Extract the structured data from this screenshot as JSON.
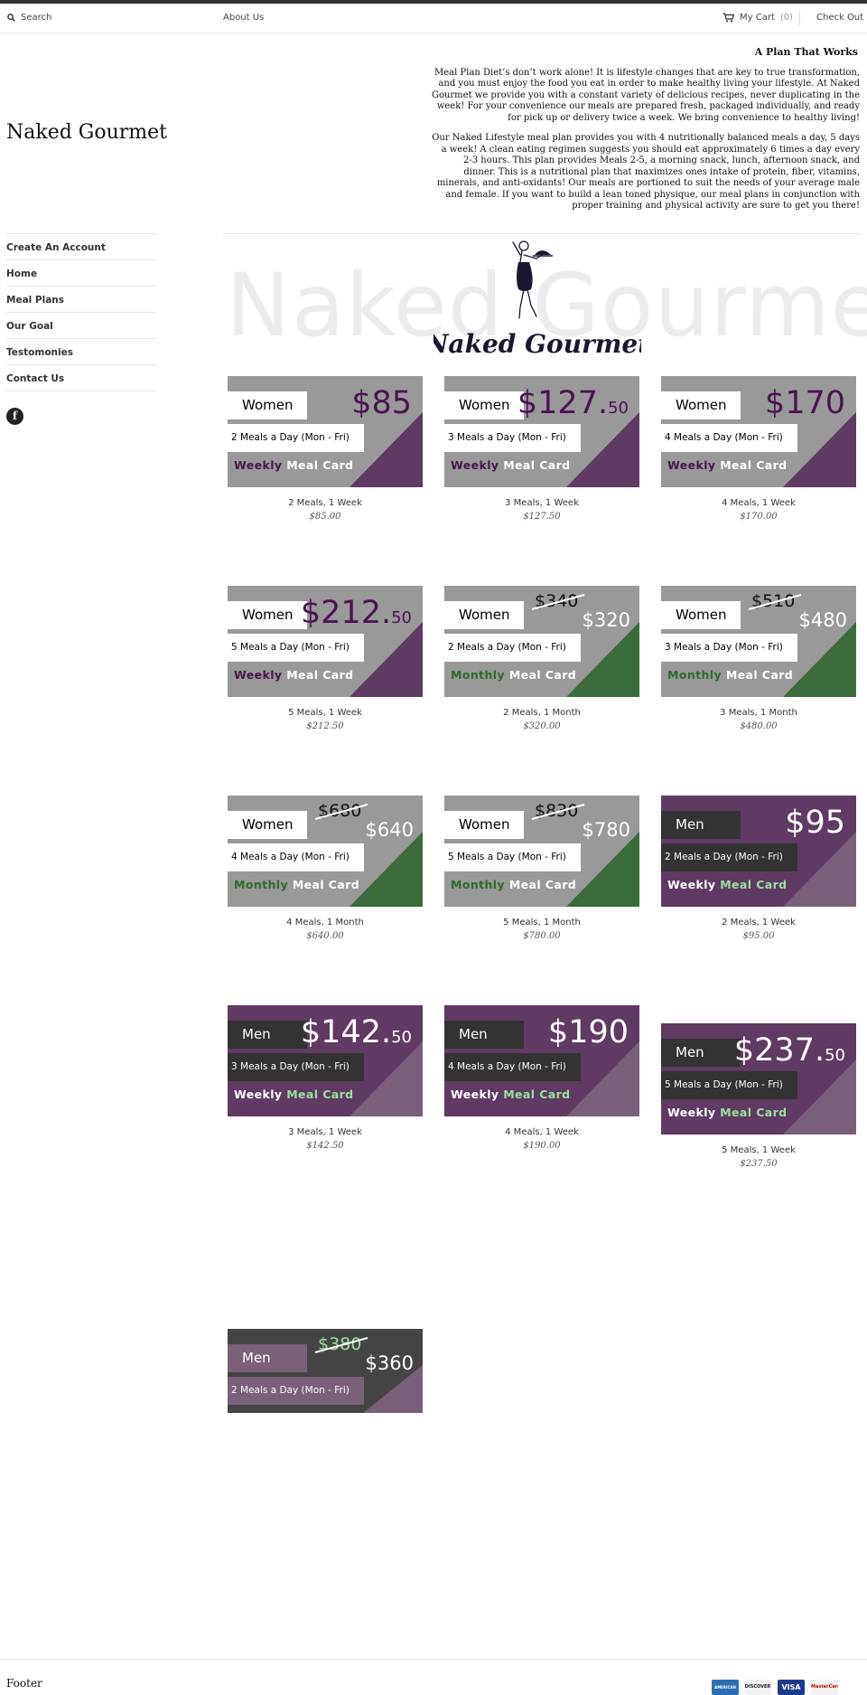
{
  "topbar": {
    "search_label": "Search",
    "about_label": "About Us",
    "cart_label": "My Cart",
    "cart_count": "(0)",
    "checkout_label": "Check Out"
  },
  "brand": {
    "name": "Naked Gourmet"
  },
  "sidebar": {
    "items": [
      {
        "label": "Create An Account"
      },
      {
        "label": "Home"
      },
      {
        "label": "Meal Plans"
      },
      {
        "label": "Our Goal"
      },
      {
        "label": "Testomonies"
      },
      {
        "label": "Contact Us"
      }
    ],
    "social_icon": "facebook-icon"
  },
  "intro": {
    "heading": "A Plan That Works",
    "p1": "Meal Plan Diet’s don’t work alone! It is lifestyle changes that are key to true transformation, and you must enjoy the food you eat in order to make healthy living your lifestyle. At Naked Gourmet we provide you with a constant variety of delicious recipes, never duplicating in the week! For your convenience our meals are prepared fresh, packaged individually, and ready for pick up or delivery twice a week. We bring convenience to healthy living!",
    "p2": "Our Naked Lifestyle meal plan provides you with 4 nutritionally balanced meals a day, 5 days a week! A clean eating regimen suggests you should eat approximately 6 times a day every 2-3 hours. This plan provides Meals 2-5, a morning snack, lunch, afternoon snack, and dinner. This is a nutritional plan that maximizes ones intake of protein, fiber, vitamins, minerals, and anti-oxidants! Our meals are portioned to suit the needs of your average male and female. If you want to build a lean toned physique, our meal plans in conjunction with proper training and physical activity are sure to get you there!"
  },
  "banner": {
    "watermark": "Naked Gourmet",
    "logo_text": "Naked Gourmet"
  },
  "colors": {
    "women_bg": "#999999",
    "women_weekly_accent": "#5f3a63",
    "women_monthly_accent": "#3b6b3d",
    "men_bg": "#5f3a63",
    "men_accent": "#7a5f7a",
    "dark_bg": "#444444",
    "price_purple": "#4a1450",
    "monthly_green": "#2e6b2e",
    "men_label_green": "#9be09b"
  },
  "products": [
    {
      "title": "2 Meals, 1 Week",
      "price": "$85.00",
      "gender": "Women",
      "meals": "2 Meals a Day (Mon - Fri)",
      "card_price": "$85",
      "card_cents": "",
      "old_price": "",
      "plan": "Weekly",
      "card_word": "Meal Card"
    },
    {
      "title": "3 Meals, 1 Week",
      "price": "$127.50",
      "gender": "Women",
      "meals": "3 Meals a Day (Mon - Fri)",
      "card_price": "$127.",
      "card_cents": "50",
      "old_price": "",
      "plan": "Weekly",
      "card_word": "Meal Card"
    },
    {
      "title": "4 Meals, 1 Week",
      "price": "$170.00",
      "gender": "Women",
      "meals": "4 Meals a Day (Mon - Fri)",
      "card_price": "$170",
      "card_cents": "",
      "old_price": "",
      "plan": "Weekly",
      "card_word": "Meal Card"
    },
    {
      "title": "5 Meals, 1 Week",
      "price": "$212.50",
      "gender": "Women",
      "meals": "5 Meals a Day (Mon - Fri)",
      "card_price": "$212.",
      "card_cents": "50",
      "old_price": "",
      "plan": "Weekly",
      "card_word": "Meal Card"
    },
    {
      "title": "2 Meals, 1 Month",
      "price": "$320.00",
      "gender": "Women",
      "meals": "2 Meals a Day (Mon - Fri)",
      "card_price": "$320",
      "card_cents": "",
      "old_price": "$340",
      "plan": "Monthly",
      "card_word": "Meal Card"
    },
    {
      "title": "3 Meals, 1 Month",
      "price": "$480.00",
      "gender": "Women",
      "meals": "3 Meals a Day (Mon - Fri)",
      "card_price": "$480",
      "card_cents": "",
      "old_price": "$510",
      "plan": "Monthly",
      "card_word": "Meal Card"
    },
    {
      "title": "4 Meals, 1 Month",
      "price": "$640.00",
      "gender": "Women",
      "meals": "4 Meals a Day (Mon - Fri)",
      "card_price": "$640",
      "card_cents": "",
      "old_price": "$680",
      "plan": "Monthly",
      "card_word": "Meal Card"
    },
    {
      "title": "5 Meals, 1 Month",
      "price": "$780.00",
      "gender": "Women",
      "meals": "5 Meals a Day (Mon - Fri)",
      "card_price": "$780",
      "card_cents": "",
      "old_price": "$830",
      "plan": "Monthly",
      "card_word": "Meal Card"
    },
    {
      "title": "2 Meals, 1 Week",
      "price": "$95.00",
      "gender": "Men",
      "meals": "2 Meals a Day (Mon - Fri)",
      "card_price": "$95",
      "card_cents": "",
      "old_price": "",
      "plan": "Weekly",
      "card_word": "Meal Card"
    },
    {
      "title": "3 Meals, 1 Week",
      "price": "$142.50",
      "gender": "Men",
      "meals": "3 Meals a Day (Mon - Fri)",
      "card_price": "$142.",
      "card_cents": "50",
      "old_price": "",
      "plan": "Weekly",
      "card_word": "Meal Card"
    },
    {
      "title": "4 Meals, 1 Week",
      "price": "$190.00",
      "gender": "Men",
      "meals": "4 Meals a Day (Mon - Fri)",
      "card_price": "$190",
      "card_cents": "",
      "old_price": "",
      "plan": "Weekly",
      "card_word": "Meal Card"
    },
    {
      "title": "5 Meals, 1 Week",
      "price": "$237.50",
      "gender": "Men",
      "meals": "5 Meals a Day (Mon - Fri)",
      "card_price": "$237.",
      "card_cents": "50",
      "old_price": "",
      "plan": "Weekly",
      "card_word": "Meal Card"
    },
    {
      "title": "",
      "price": "",
      "gender": "Men",
      "meals": "2 Meals a Day (Mon - Fri)",
      "card_price": "$360",
      "card_cents": "",
      "old_price": "$380",
      "plan": "",
      "card_word": ""
    }
  ],
  "footer": {
    "label": "Footer",
    "payment_icons": [
      {
        "name": "amex-icon",
        "text": "AMERICAN EXPRESS"
      },
      {
        "name": "discover-icon",
        "text": "DISCOVER"
      },
      {
        "name": "visa-icon",
        "text": "VISA"
      },
      {
        "name": "mastercard-icon",
        "text": "MasterCard"
      }
    ]
  }
}
